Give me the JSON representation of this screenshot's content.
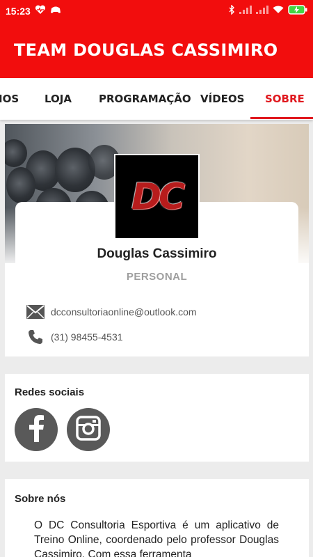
{
  "status_bar": {
    "time": "15:23",
    "battery_color": "#43d643"
  },
  "app_bar": {
    "title": "TEAM DOUGLAS CASSIMIRO",
    "color": "#f20d0d"
  },
  "tabs": [
    {
      "label": "IOS",
      "active": false
    },
    {
      "label": "LOJA",
      "active": false
    },
    {
      "label": "PROGRAMAÇÃO",
      "active": false
    },
    {
      "label": "VÍDEOS",
      "active": false
    },
    {
      "label": "SOBRE",
      "active": true
    }
  ],
  "profile": {
    "logo_text": "DC",
    "name": "Douglas Cassimiro",
    "role": "PERSONAL",
    "email": "dcconsultoriaonline@outlook.com",
    "phone": "(31) 98455-4531"
  },
  "social": {
    "title": "Redes sociais",
    "links": [
      "facebook-icon",
      "instagram-icon"
    ]
  },
  "about": {
    "title": "Sobre nós",
    "text": "O DC Consultoria Esportiva é um aplicativo de Treino Online, coordenado pelo professor Douglas Cassimiro. Com essa ferramenta"
  },
  "accent_color": "#e0191f"
}
